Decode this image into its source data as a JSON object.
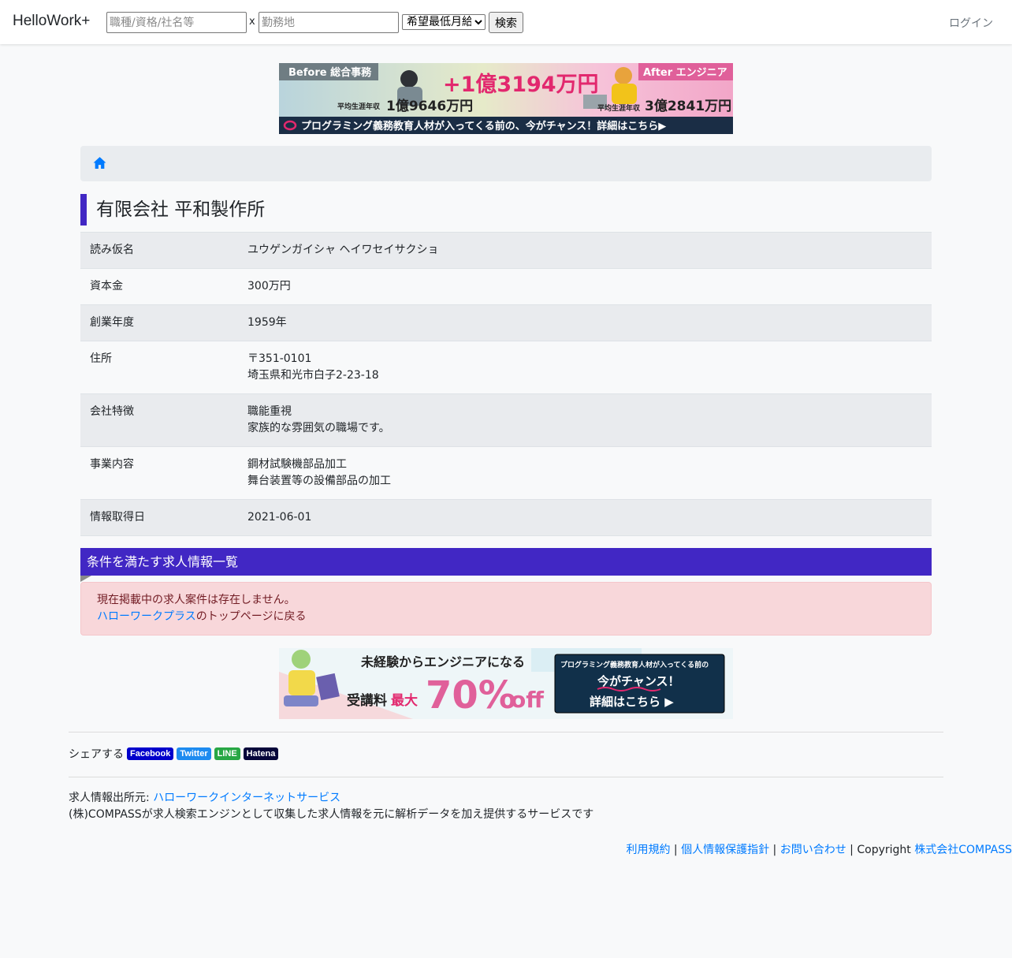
{
  "nav": {
    "brand": "HelloWork+",
    "keyword_placeholder": "職種/資格/社名等",
    "times": "x",
    "location_placeholder": "勤務地",
    "salary_selected": "希望最低月給",
    "search_label": "検索",
    "login_label": "ログイン"
  },
  "banner_top": {
    "before_label": "Before 総合事務",
    "after_label": "After エンジニア",
    "diff": "+1億3194万円",
    "before_caption": "平均生涯年収",
    "before_value": "1億9646万円",
    "after_caption": "平均生涯年収",
    "after_value": "3億2841万円",
    "footer_text": "プログラミング義務教育人材が入ってくる前の、今がチャンス！詳細はこちら▶"
  },
  "company": {
    "name": "有限会社 平和製作所",
    "rows": [
      {
        "label": "読み仮名",
        "lines": [
          "ユウゲンガイシャ ヘイワセイサクショ"
        ]
      },
      {
        "label": "資本金",
        "lines": [
          "300万円"
        ]
      },
      {
        "label": "創業年度",
        "lines": [
          "1959年"
        ]
      },
      {
        "label": "住所",
        "lines": [
          "〒351-0101",
          "埼玉県和光市白子2-23-18"
        ]
      },
      {
        "label": "会社特徴",
        "lines": [
          "職能重視",
          "家族的な雰囲気の職場です。"
        ]
      },
      {
        "label": "事業内容",
        "lines": [
          "鋼材試験機部品加工",
          "舞台装置等の設備部品の加工"
        ]
      },
      {
        "label": "情報取得日",
        "lines": [
          "2021-06-01"
        ]
      }
    ]
  },
  "jobs_section": {
    "heading": "条件を満たす求人情報一覧",
    "empty_message": "現在掲載中の求人案件は存在しません。",
    "top_link": "ハローワークプラス",
    "top_link_suffix": "のトップページに戻る"
  },
  "banner_bottom": {
    "line1": "未経験からエンジニアになる",
    "fee_label": "受講料",
    "max_label": "最大",
    "discount": "70%",
    "off": "off",
    "box_line1": "プログラミング義務教育人材が入ってくる前の",
    "box_line2": "今がチャンス！",
    "box_line3": "詳細はこちら ▶"
  },
  "share": {
    "label": "シェアする",
    "buttons": [
      {
        "label": "Facebook",
        "color": "#0000cc"
      },
      {
        "label": "Twitter",
        "color": "#1d8bf0"
      },
      {
        "label": "LINE",
        "color": "#28a745"
      },
      {
        "label": "Hatena",
        "color": "#06063a"
      }
    ]
  },
  "source": {
    "prefix": "求人情報出所元: ",
    "link": "ハローワークインターネットサービス",
    "note": "(株)COMPASSが求人検索エンジンとして収集した求人情報を元に解析データを加え提供するサービスです"
  },
  "footer": {
    "terms": "利用規約",
    "privacy": "個人情報保護指針",
    "contact": "お問い合わせ",
    "sep": " | ",
    "copyright": "Copyright ",
    "company": "株式会社COMPASS"
  },
  "colors": {
    "accent": "#4127c4",
    "link": "#007bff",
    "alert_bg": "#f8d7da",
    "alert_text": "#721c24"
  }
}
